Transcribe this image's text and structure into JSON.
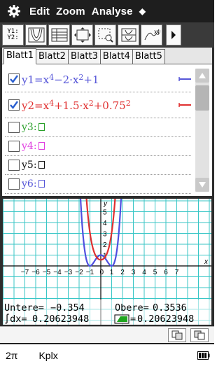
{
  "menubar": {
    "items": [
      "Edit",
      "Zoom",
      "Analyse",
      "◆"
    ]
  },
  "toolbar": {
    "y1_label": "Y1:",
    "y2_label": "Y2:"
  },
  "editor": {
    "tabs": [
      "Blatt1",
      "Blatt2",
      "Blatt3",
      "Blatt4",
      "Blatt5"
    ],
    "functions": [
      {
        "name": "y1=",
        "parts": [
          "x",
          "4",
          "−2·x",
          "2",
          "+1"
        ],
        "checked": true,
        "color": "#5656d8",
        "line": true
      },
      {
        "name": "y2=",
        "parts": [
          "x",
          "4",
          "+1.5·x",
          "2",
          "+0.75",
          "2"
        ],
        "checked": true,
        "color": "#e03030",
        "line": true
      },
      {
        "name": "y3:",
        "checked": false,
        "color": "#2aa02a"
      },
      {
        "name": "y4:",
        "checked": false,
        "color": "#e040e0"
      },
      {
        "name": "y5:",
        "checked": false,
        "color": "#111111"
      },
      {
        "name": "y6:",
        "checked": false,
        "color": "#5656d8"
      }
    ]
  },
  "graph": {
    "x_ticks": [
      "−7",
      "−6",
      "−5",
      "−4",
      "−3",
      "−2",
      "−1",
      "0",
      "1",
      "2",
      "3",
      "4",
      "5",
      "6",
      "7"
    ],
    "y_ticks": [
      "1",
      "2",
      "3",
      "4",
      "5"
    ],
    "x_label": "x",
    "y_label": "y",
    "origin_label": "0",
    "lower_label": "Untere=",
    "lower_value": "−0.354",
    "upper_label": "Obere=",
    "upper_value": "0.3536",
    "integral_label": "∫dx=",
    "integral_value": "0.20623948",
    "area_label": "=",
    "area_value": "0.20623948",
    "colors": {
      "grid": "#38c6c6",
      "y1": "#4f4fe0",
      "y2": "#e03030"
    }
  },
  "statusbar": {
    "angle": "2π",
    "mode": "Kplx"
  }
}
